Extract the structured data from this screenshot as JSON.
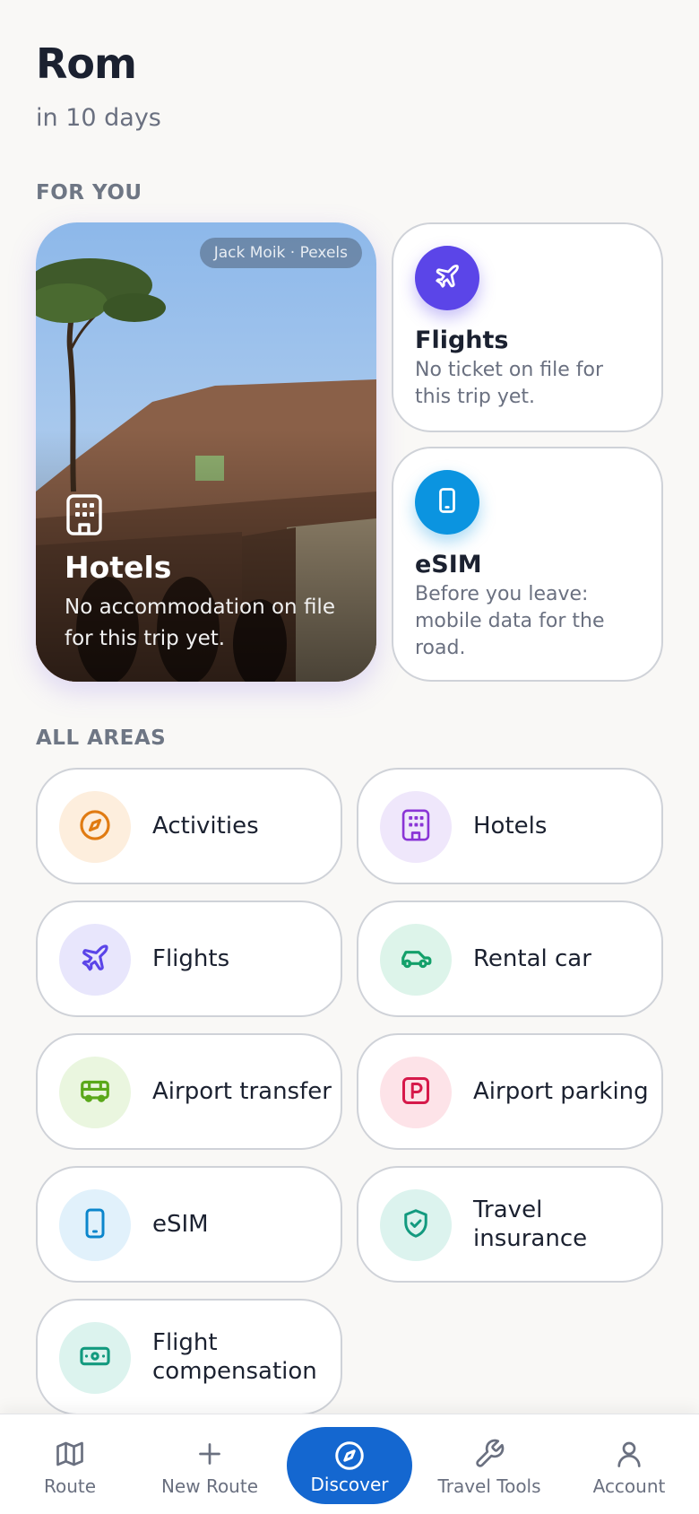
{
  "header": {
    "title": "Rom",
    "subtitle": "in 10 days"
  },
  "sections": {
    "for_you": "FOR YOU",
    "all_areas": "ALL AREAS"
  },
  "hero": {
    "credit": "Jack Moik · Pexels",
    "title": "Hotels",
    "description": "No accommodation on file for this trip yet.",
    "icon": "hotel-icon"
  },
  "cards": {
    "flights": {
      "title": "Flights",
      "description": "No ticket on file for this trip yet.",
      "icon": "plane-icon",
      "color": "#5b45e8"
    },
    "esim": {
      "title": "eSIM",
      "description": "Before you leave: mobile data for the road.",
      "icon": "phone-icon",
      "color": "#0b94e0"
    }
  },
  "areas": [
    {
      "label": "Activities",
      "icon": "compass-icon",
      "bg": "#fdeedd",
      "color": "#e07b12"
    },
    {
      "label": "Hotels",
      "icon": "hotel-icon",
      "bg": "#efe7fb",
      "color": "#8a34d6"
    },
    {
      "label": "Flights",
      "icon": "plane-icon",
      "bg": "#e8e6fc",
      "color": "#5b45e8"
    },
    {
      "label": "Rental car",
      "icon": "car-icon",
      "bg": "#ddf4ea",
      "color": "#13a06a"
    },
    {
      "label": "Airport transfer",
      "icon": "bus-icon",
      "bg": "#eaf6df",
      "color": "#5aa81a"
    },
    {
      "label": "Airport parking",
      "icon": "parking-icon",
      "bg": "#fde3e8",
      "color": "#d6194a"
    },
    {
      "label": "eSIM",
      "icon": "phone-icon",
      "bg": "#e1f1fb",
      "color": "#0b86cc"
    },
    {
      "label": "Travel insurance",
      "icon": "shield-icon",
      "bg": "#dcf3ee",
      "color": "#139a7f"
    },
    {
      "label": "Flight compensation",
      "icon": "money-icon",
      "bg": "#dcf3ee",
      "color": "#139a7f"
    }
  ],
  "nav": {
    "route": "Route",
    "new_route": "New Route",
    "discover": "Discover",
    "travel_tools": "Travel Tools",
    "account": "Account",
    "active_color": "#1467d0"
  }
}
